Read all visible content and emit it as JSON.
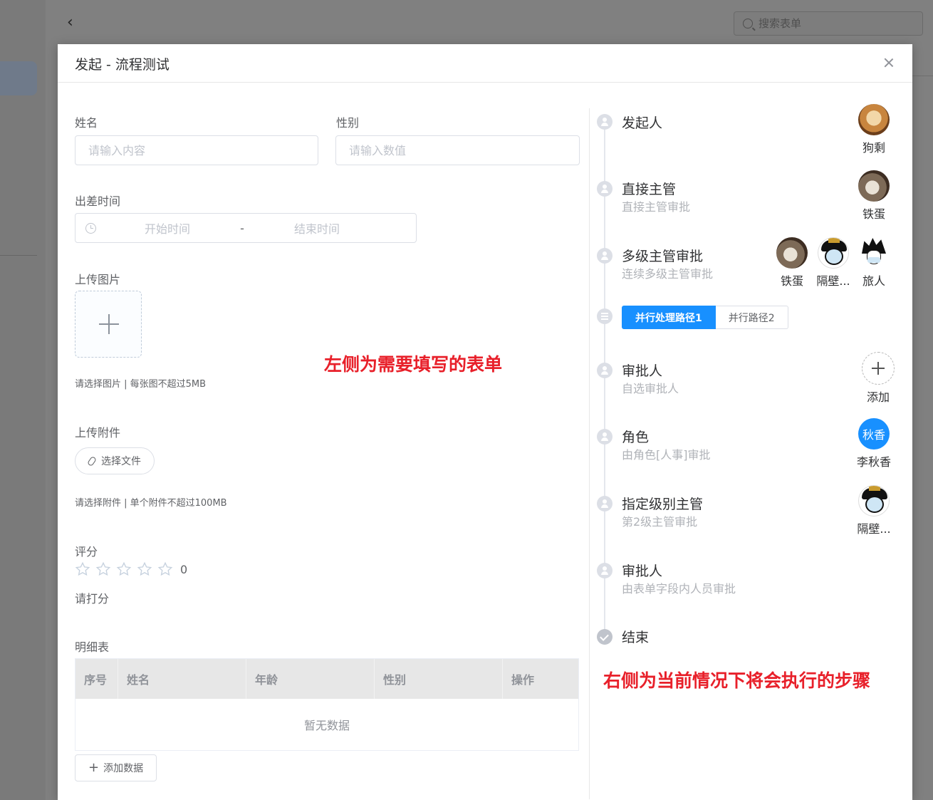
{
  "background": {
    "search_placeholder": "搜索表单"
  },
  "dialog": {
    "title": "发起 - 流程测试"
  },
  "form": {
    "name": {
      "label": "姓名",
      "placeholder": "请输入内容"
    },
    "gender": {
      "label": "性别",
      "placeholder": "请输入数值"
    },
    "trip_time": {
      "label": "出差时间",
      "start_placeholder": "开始时间",
      "separator": "-",
      "end_placeholder": "结束时间"
    },
    "upload_image": {
      "label": "上传图片",
      "hint": "请选择图片 | 每张图不超过5MB"
    },
    "upload_file": {
      "label": "上传附件",
      "button": "选择文件",
      "hint": "请选择附件 | 单个附件不超过100MB"
    },
    "rating": {
      "label": "评分",
      "value": 0,
      "max": 5,
      "value_text": "0",
      "hint": "请打分"
    },
    "detail_table": {
      "label": "明细表",
      "columns": [
        "序号",
        "姓名",
        "年龄",
        "性别",
        "操作"
      ],
      "rows": [],
      "empty_text": "暂无数据",
      "add_button": "添加数据"
    }
  },
  "annotations": {
    "left": "左侧为需要填写的表单",
    "right": "右侧为当前情况下将会执行的步骤"
  },
  "process": {
    "nodes": [
      {
        "title": "发起人",
        "subtitle": "",
        "users": [
          {
            "name": "狗剩",
            "avatar": "dog-photo"
          }
        ]
      },
      {
        "title": "直接主管",
        "subtitle": "直接主管审批",
        "users": [
          {
            "name": "铁蛋",
            "avatar": "cat-photo"
          }
        ]
      },
      {
        "title": "多级主管审批",
        "subtitle": "连续多级主管审批",
        "users": [
          {
            "name": "铁蛋",
            "avatar": "cat-photo"
          },
          {
            "name": "隔壁...",
            "avatar": "meme-face"
          },
          {
            "name": "旅人",
            "avatar": "anime-boy"
          }
        ]
      },
      {
        "branch_tabs": [
          "并行处理路径1",
          "并行路径2"
        ],
        "active_tab": 0
      },
      {
        "title": "审批人",
        "subtitle": "自选审批人",
        "users": [
          {
            "name": "添加",
            "avatar": "add-plus"
          }
        ]
      },
      {
        "title": "角色",
        "subtitle": "由角色[人事]审批",
        "users": [
          {
            "name": "李秋香",
            "avatar_text": "秋香",
            "color": "#1890ff"
          }
        ]
      },
      {
        "title": "指定级别主管",
        "subtitle": "第2级主管审批",
        "users": [
          {
            "name": "隔壁...",
            "avatar": "meme-face"
          }
        ]
      },
      {
        "title": "审批人",
        "subtitle": "由表单字段内人员审批",
        "users": []
      },
      {
        "title": "结束"
      }
    ]
  },
  "colors": {
    "primary": "#1890ff",
    "annotation": "#e8202a"
  }
}
